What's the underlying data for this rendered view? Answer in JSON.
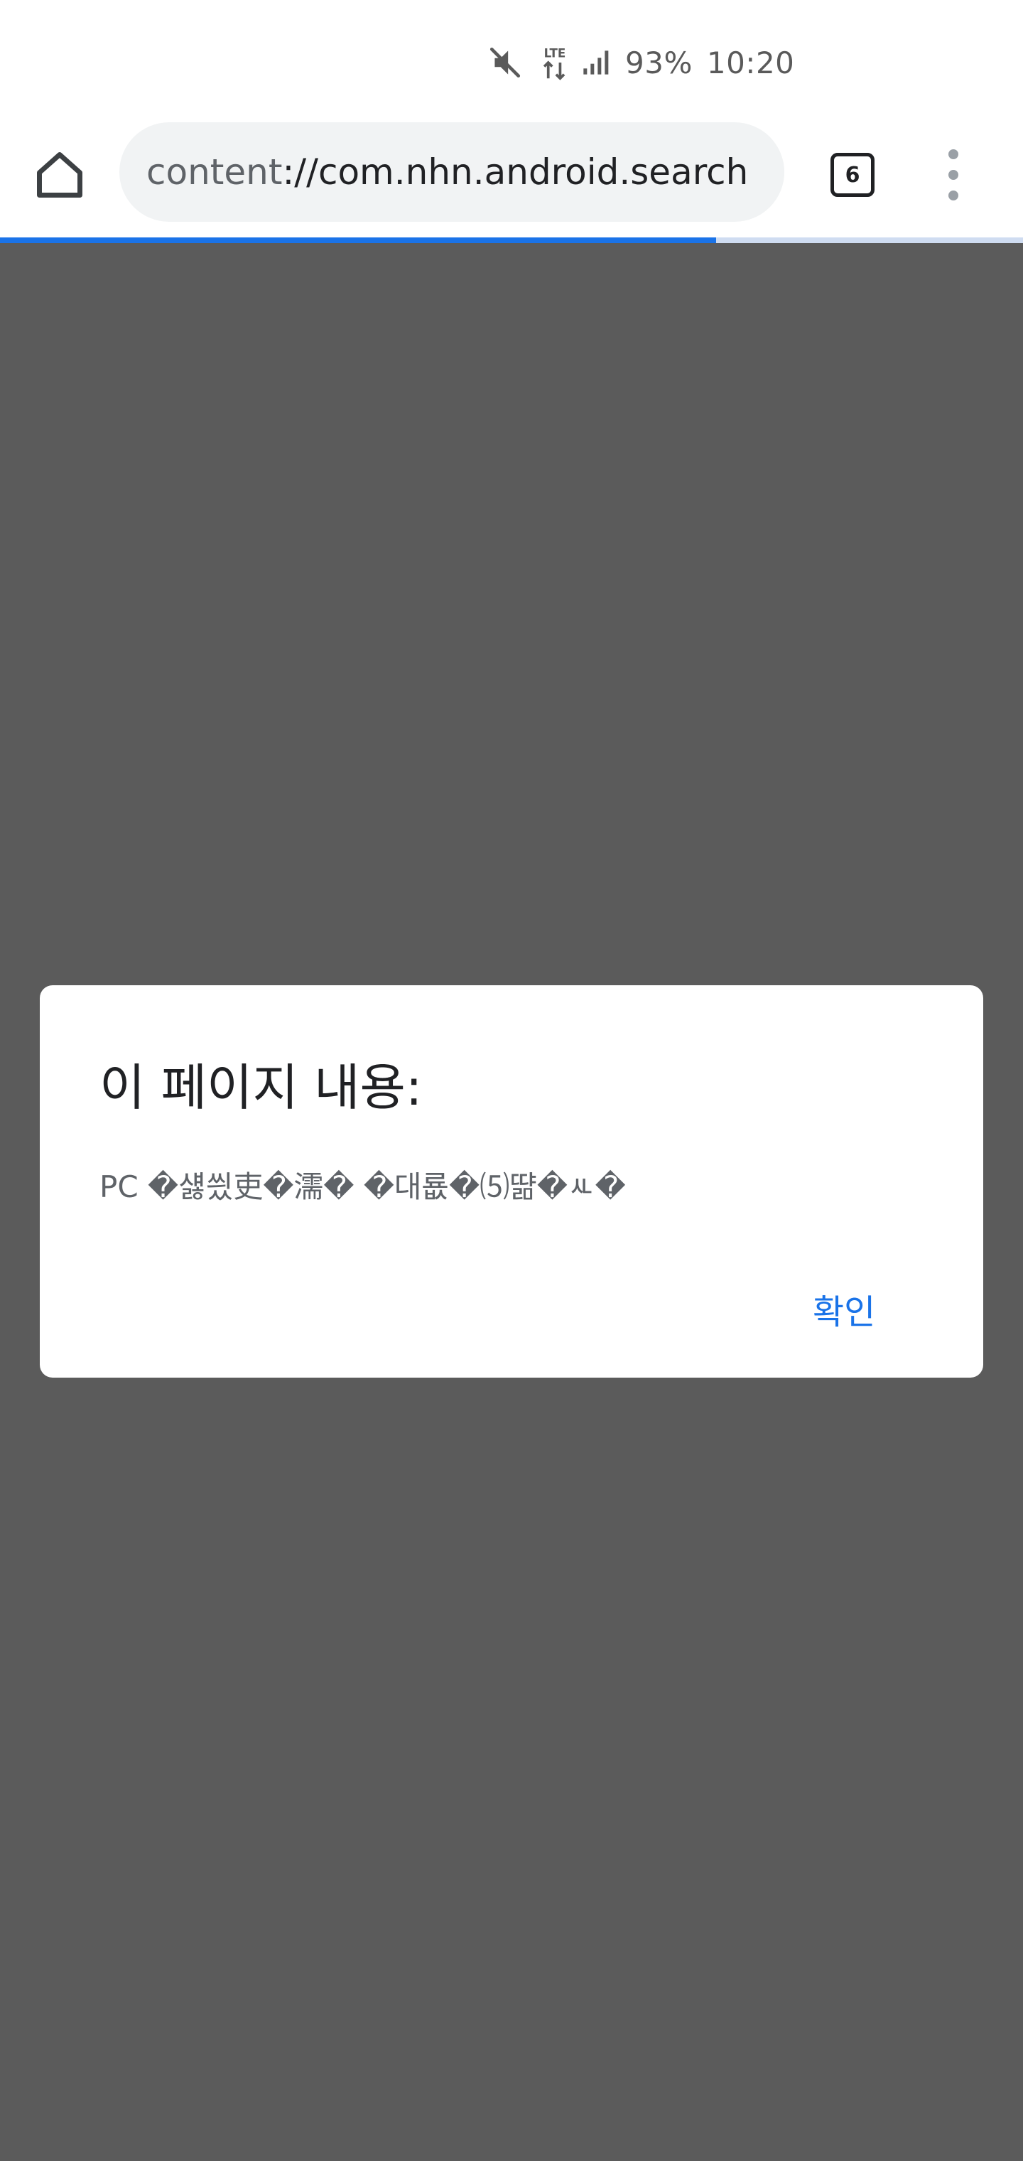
{
  "status_bar": {
    "icons": [
      "mute-icon",
      "lte-data-icon",
      "signal-icon"
    ],
    "network_label": "LTE",
    "battery": "93%",
    "time": "10:20"
  },
  "toolbar": {
    "home_icon": "home-icon",
    "url_scheme": "content",
    "url_rest": "://com.nhn.android.search",
    "tab_count": "6",
    "menu_icon": "more-vert-icon"
  },
  "progress": {
    "value": 0.7
  },
  "dialog": {
    "title": "이 페이지 내용:",
    "message": "PC �섏씠吏�濡� �대룞�⑸땲�ㅻ�",
    "ok_label": "확인"
  },
  "colors": {
    "overlay": "#5b5b5b",
    "accent": "#1a73e8",
    "url_bar": "#f1f3f4"
  }
}
